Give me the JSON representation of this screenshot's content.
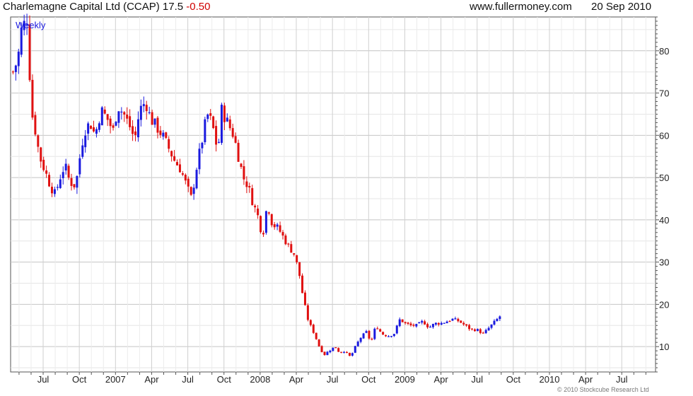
{
  "header": {
    "title_main": "Charlemagne Capital Ltd (CCAP) 17.5",
    "title_change": "-0.50",
    "site": "www.fullermoney.com",
    "date": "20 Sep 2010"
  },
  "footer": {
    "copyright": "© 2010 Stockcube Research Ltd"
  },
  "colors": {
    "up": "#1a1adf",
    "down": "#e01010",
    "grid": "#cccccc",
    "frame": "#555555"
  },
  "chart_data": {
    "type": "candlestick",
    "label": "Weekly",
    "y_ticks": [
      10,
      20,
      30,
      40,
      50,
      60,
      70,
      80
    ],
    "ylim": [
      4,
      88
    ],
    "x_ticks": [
      {
        "label": "Jul",
        "month": 6
      },
      {
        "label": "Oct",
        "month": 9
      },
      {
        "label": "2007",
        "month": 12
      },
      {
        "label": "Apr",
        "month": 15
      },
      {
        "label": "Jul",
        "month": 18
      },
      {
        "label": "Oct",
        "month": 21
      },
      {
        "label": "2008",
        "month": 24
      },
      {
        "label": "Apr",
        "month": 27
      },
      {
        "label": "Jul",
        "month": 30
      },
      {
        "label": "Oct",
        "month": 33
      },
      {
        "label": "2009",
        "month": 36
      },
      {
        "label": "Apr",
        "month": 39
      },
      {
        "label": "Jul",
        "month": 42
      },
      {
        "label": "Oct",
        "month": 45
      },
      {
        "label": "2010",
        "month": 48
      },
      {
        "label": "Apr",
        "month": 51
      },
      {
        "label": "Jul",
        "month": 54
      }
    ],
    "x_range_months": [
      3.3,
      56.8
    ],
    "close_path": [
      [
        3.5,
        75
      ],
      [
        3.9,
        78
      ],
      [
        4.2,
        85
      ],
      [
        4.7,
        88
      ],
      [
        5.0,
        66
      ],
      [
        5.3,
        62
      ],
      [
        5.7,
        55
      ],
      [
        6.1,
        52
      ],
      [
        6.6,
        48
      ],
      [
        7.0,
        46
      ],
      [
        7.4,
        50
      ],
      [
        7.8,
        53
      ],
      [
        8.2,
        49
      ],
      [
        8.7,
        48
      ],
      [
        9.0,
        54
      ],
      [
        9.4,
        61
      ],
      [
        9.9,
        63
      ],
      [
        10.3,
        60
      ],
      [
        10.8,
        66
      ],
      [
        11.3,
        64
      ],
      [
        11.8,
        61
      ],
      [
        12.2,
        67
      ],
      [
        12.7,
        65
      ],
      [
        13.2,
        62
      ],
      [
        13.6,
        59
      ],
      [
        14.0,
        66
      ],
      [
        14.5,
        68
      ],
      [
        14.9,
        64
      ],
      [
        15.4,
        62
      ],
      [
        15.9,
        60
      ],
      [
        16.4,
        57
      ],
      [
        16.9,
        54
      ],
      [
        17.4,
        52
      ],
      [
        17.9,
        48
      ],
      [
        18.3,
        45
      ],
      [
        18.7,
        52
      ],
      [
        19.2,
        59
      ],
      [
        19.6,
        65
      ],
      [
        20.0,
        63
      ],
      [
        20.5,
        56
      ],
      [
        20.8,
        66
      ],
      [
        21.3,
        63
      ],
      [
        21.8,
        60
      ],
      [
        22.2,
        55
      ],
      [
        22.6,
        50
      ],
      [
        23.0,
        48
      ],
      [
        23.4,
        44
      ],
      [
        23.8,
        41
      ],
      [
        24.2,
        36
      ],
      [
        24.6,
        44
      ],
      [
        25.0,
        39
      ],
      [
        25.5,
        38
      ],
      [
        25.9,
        36
      ],
      [
        26.3,
        34
      ],
      [
        26.8,
        32
      ],
      [
        27.2,
        28
      ],
      [
        27.6,
        21
      ],
      [
        28.0,
        16
      ],
      [
        28.5,
        13
      ],
      [
        28.9,
        10
      ],
      [
        29.3,
        8
      ],
      [
        29.7,
        9
      ],
      [
        30.2,
        10
      ],
      [
        30.6,
        8.5
      ],
      [
        31.0,
        9
      ],
      [
        31.5,
        7.5
      ],
      [
        31.9,
        10
      ],
      [
        32.3,
        12
      ],
      [
        32.8,
        13.5
      ],
      [
        33.2,
        11
      ],
      [
        33.6,
        15
      ],
      [
        34.1,
        13
      ],
      [
        34.6,
        12.5
      ],
      [
        35.1,
        13
      ],
      [
        35.6,
        16.5
      ],
      [
        36.0,
        15.5
      ],
      [
        36.5,
        15
      ],
      [
        37.0,
        15
      ],
      [
        37.5,
        16
      ],
      [
        38.0,
        14.5
      ],
      [
        38.5,
        15.5
      ],
      [
        39.0,
        15.5
      ],
      [
        39.5,
        16
      ],
      [
        40.0,
        16.5
      ],
      [
        40.5,
        16
      ],
      [
        41.0,
        15
      ],
      [
        41.5,
        14
      ],
      [
        42.0,
        14
      ],
      [
        42.5,
        13
      ],
      [
        43.0,
        14.5
      ],
      [
        43.5,
        16
      ],
      [
        44.0,
        17.5
      ]
    ]
  }
}
